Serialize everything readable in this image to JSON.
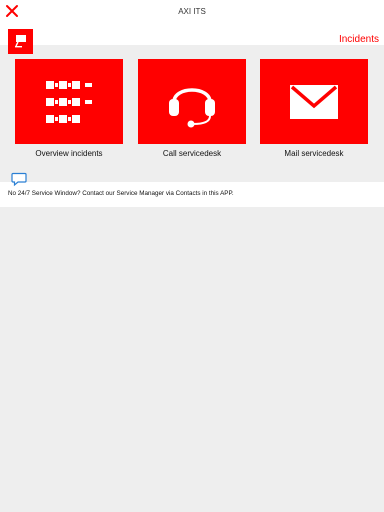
{
  "app": {
    "title": "AXI ITS"
  },
  "header": {
    "section_link": "Incidents"
  },
  "tiles": [
    {
      "label": "Overview incidents",
      "icon": "list-grid-icon"
    },
    {
      "label": "Call servicedesk",
      "icon": "headset-icon"
    },
    {
      "label": "Mail servicedesk",
      "icon": "envelope-icon"
    }
  ],
  "notice": {
    "icon": "chat-bubble-icon",
    "text": "No 24/7 Service Window? Contact our Service Manager via Contacts in this APP."
  },
  "colors": {
    "accent": "#ff0000",
    "background": "#eeeeee",
    "surface": "#ffffff"
  }
}
